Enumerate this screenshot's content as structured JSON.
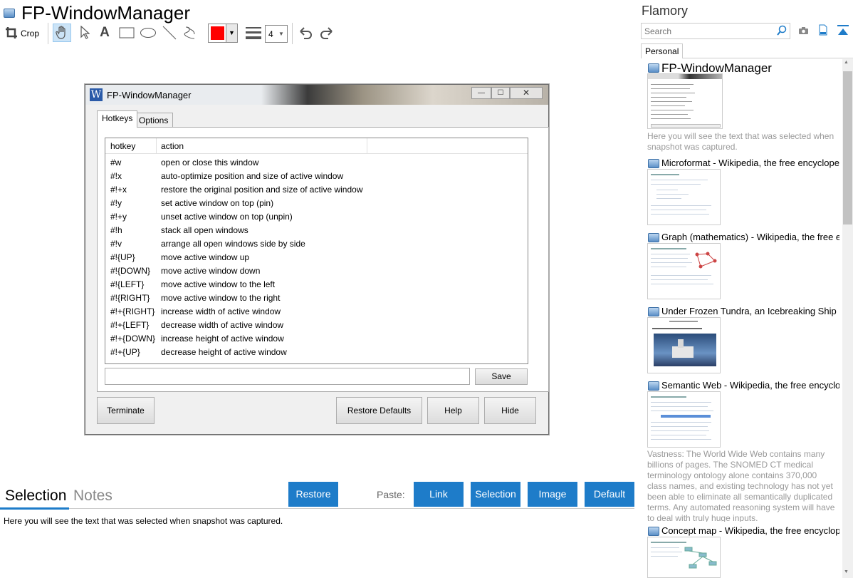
{
  "app": {
    "title": "FP-WindowManager"
  },
  "toolbar": {
    "crop_label": "Crop",
    "line_width": "4",
    "color": "#ff0000"
  },
  "window": {
    "title": "FP-WindowManager",
    "tabs": [
      "Hotkeys",
      "Options"
    ],
    "columns": {
      "hotkey": "hotkey",
      "action": "action"
    },
    "rows": [
      {
        "hotkey": "#w",
        "action": "open or close this window"
      },
      {
        "hotkey": "#!x",
        "action": "auto-optimize position and size of active window"
      },
      {
        "hotkey": "#!+x",
        "action": "restore the original position and size of active window"
      },
      {
        "hotkey": "#!y",
        "action": "set active window on top (pin)"
      },
      {
        "hotkey": "#!+y",
        "action": "unset active window on top (unpin)"
      },
      {
        "hotkey": "#!h",
        "action": "stack all open windows"
      },
      {
        "hotkey": "#!v",
        "action": "arrange all open windows side by side"
      },
      {
        "hotkey": "#!{UP}",
        "action": "move active window up"
      },
      {
        "hotkey": "#!{DOWN}",
        "action": "move active window down"
      },
      {
        "hotkey": "#!{LEFT}",
        "action": "move active window to the left"
      },
      {
        "hotkey": "#!{RIGHT}",
        "action": "move active window to the right"
      },
      {
        "hotkey": "#!+{RIGHT}",
        "action": "increase width of active window"
      },
      {
        "hotkey": "#!+{LEFT}",
        "action": "decrease width of active window"
      },
      {
        "hotkey": "#!+{DOWN}",
        "action": "increase height of active window"
      },
      {
        "hotkey": "#!+{UP}",
        "action": "decrease height of active window"
      }
    ],
    "save": "Save",
    "terminate": "Terminate",
    "restore_defaults": "Restore Defaults",
    "help": "Help",
    "hide": "Hide"
  },
  "bottom": {
    "tab_selection": "Selection",
    "tab_notes": "Notes",
    "restore": "Restore",
    "paste_label": "Paste:",
    "link": "Link",
    "selection": "Selection",
    "image": "Image",
    "default": "Default",
    "selection_text": "Here you will see the text that was selected when snapshot was captured.",
    "accent": "#1e7cc9"
  },
  "sidebar": {
    "title": "Flamory",
    "search_placeholder": "Search",
    "tab": "Personal",
    "items": [
      {
        "title": "FP-WindowManager",
        "caption": "Here you will see the text that was selected when snapshot was captured."
      },
      {
        "title": "Microformat - Wikipedia, the free encyclopedia"
      },
      {
        "title": "Graph (mathematics) - Wikipedia, the free ency"
      },
      {
        "title": "Under Frozen Tundra, an Icebreaking Ship Unco"
      },
      {
        "title": "Semantic Web - Wikipedia, the free encycloped",
        "caption": "Vastness: The World Wide Web contains many billions of pages. The SNOMED CT medical terminology ontology alone contains 370,000 class names, and existing technology has not yet been able to eliminate all semantically duplicated terms. Any automated reasoning system will have to deal with truly huge inputs."
      },
      {
        "title": "Concept map - Wikipedia, the free encyclopedi"
      }
    ]
  }
}
